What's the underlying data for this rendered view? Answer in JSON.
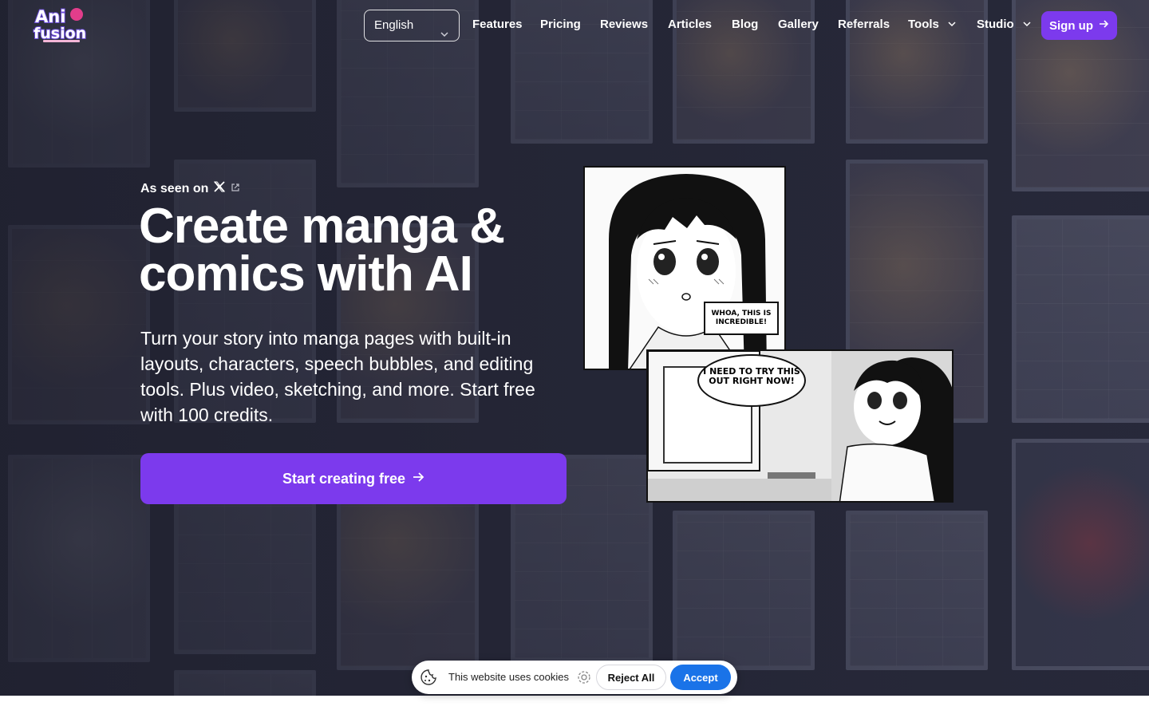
{
  "nav": {
    "language": "English",
    "links": [
      "Features",
      "Pricing",
      "Reviews",
      "Articles",
      "Blog",
      "Gallery",
      "Referrals"
    ],
    "tools_label": "Tools",
    "studio_label": "Studio",
    "signup_label": "Sign up"
  },
  "hero": {
    "seen_on": "As seen on",
    "headline_line1": "Create manga &",
    "headline_line2": "comics with AI",
    "subtext": "Turn your story into manga pages with built-in layouts, characters, speech bubbles, and editing tools. Plus video, sketching, and more. Start free with 100 credits.",
    "cta_label": "Start creating free"
  },
  "panels": {
    "speech_box": "WHOA, THIS IS INCREDIBLE!",
    "bubble": "I NEED TO TRY THIS OUT RIGHT NOW!"
  },
  "cookie": {
    "text": "This website uses cookies",
    "reject_label": "Reject All",
    "accept_label": "Accept"
  },
  "colors": {
    "brand_purple": "#7c3aed",
    "accept_blue": "#1a73e8",
    "background_dark": "#2b2d3f"
  },
  "icons": [
    "logo",
    "chevron-down-icon",
    "arrow-right-icon",
    "x-logo-icon",
    "external-link-icon",
    "cookie-icon",
    "gear-icon"
  ]
}
